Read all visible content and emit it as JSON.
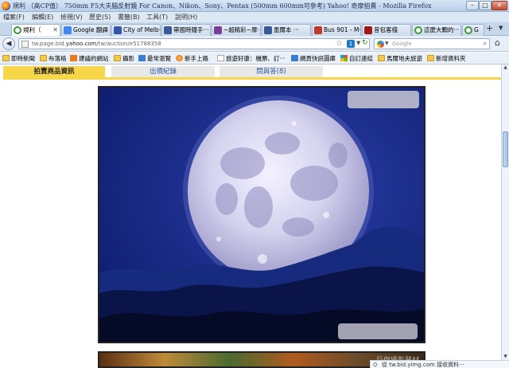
{
  "window": {
    "title": "規利 （高CP值） 750mm F5大夫腦反射鏡 For Canon、Nikon、Sony、Pentax (500mm 600mm可參考) Yahoo! 奇摩拍賣 - Mozilla Firefox",
    "min": "–",
    "max": "□",
    "close": "✕"
  },
  "menu": [
    "檔案(F)",
    "編輯(E)",
    "檢視(V)",
    "歷史(S)",
    "書籤(B)",
    "工具(T)",
    "說明(H)"
  ],
  "tabs": [
    {
      "label": "規利（",
      "color": "#3a9a3a",
      "active": true
    },
    {
      "label": "Google 翻譯",
      "color": "#4285f4"
    },
    {
      "label": "City of Melb···",
      "color": "#3355aa"
    },
    {
      "label": "帶國時鐘手···",
      "color": "#3b5998"
    },
    {
      "label": "~超精彩~摩···",
      "color": "#7a3d9a"
    },
    {
      "label": "墨爾本 ···",
      "color": "#3b5998"
    },
    {
      "label": "Bus 901 - M···",
      "color": "#c0392b"
    },
    {
      "label": "昔包客棧",
      "color": "#a01818"
    },
    {
      "label": "這麼大顆的···",
      "color": "#3a9a3a"
    },
    {
      "label": "G",
      "color": "#3a9a3a"
    }
  ],
  "nav": {
    "url_prefix": "tw.page.bid.",
    "url_domain": "yahoo.com",
    "url_path": "/tw/auction/e51788358",
    "search_placeholder": "Google",
    "info_badge": "1"
  },
  "bookmarks": [
    {
      "label": "即時新聞",
      "icon": "folder"
    },
    {
      "label": "布落格",
      "icon": "folder"
    },
    {
      "label": "建議的網站",
      "icon": "orange"
    },
    {
      "label": "攝影",
      "icon": "folder"
    },
    {
      "label": "最常瀏覽",
      "icon": "blue"
    },
    {
      "label": "新手上路",
      "icon": "firefox"
    },
    {
      "label": "旅遊好康：機票、訂···",
      "icon": "page"
    },
    {
      "label": "網頁快訊圖庫",
      "icon": "blue"
    },
    {
      "label": "自訂連結",
      "icon": "windows"
    },
    {
      "label": "馬爾地夫旅遊",
      "icon": "folder"
    },
    {
      "label": "新增資料夾",
      "icon": "folder"
    }
  ],
  "page_tabs": {
    "item_info": "拍賣商品資訊",
    "bid_history": "出價紀錄",
    "qa": "問與答(8)"
  },
  "watermark": "巨倒攝影器材",
  "status": "從 tw.bid.yimg.com 接收資料···",
  "colors": {
    "accent_yellow": "#f7d64a",
    "link_blue": "#2b56a6",
    "sky": "#0e1f78"
  }
}
